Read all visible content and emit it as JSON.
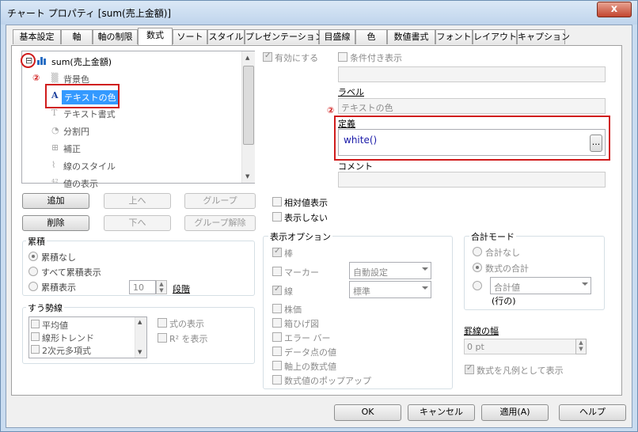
{
  "window": {
    "title": "チャート プロパティ [sum(売上金額)]",
    "close": "x"
  },
  "tabs": [
    "基本設定",
    "軸",
    "軸の制限",
    "数式",
    "ソート",
    "スタイル",
    "プレゼンテーション",
    "目盛線",
    "色",
    "数値書式",
    "フォント",
    "レイアウト",
    "キャプション"
  ],
  "tree": {
    "expander": "⊟",
    "root": "sum(売上金額)",
    "items": [
      "背景色",
      "テキストの色",
      "テキスト書式",
      "分割円",
      "補正",
      "線のスタイル",
      "値の表示"
    ],
    "selected_index": 1
  },
  "annotations": {
    "marker1": "②",
    "marker2": "②"
  },
  "buttons": {
    "add": "追加",
    "up": "上へ",
    "group": "グループ",
    "delete": "削除",
    "down": "下へ",
    "ungroup": "グループ解除",
    "ok": "OK",
    "cancel": "キャンセル",
    "apply": "適用(A)",
    "help": "ヘルプ",
    "ellipsis": "..."
  },
  "right": {
    "enabled": "有効にする",
    "conditional": "条件付き表示",
    "label_title": "ラベル",
    "label_value": "テキストの色",
    "definition_title": "定義",
    "definition_value": "white()",
    "comment_title": "コメント"
  },
  "accumulation": {
    "title": "累積",
    "options": [
      "累積なし",
      "すべて累積表示",
      "累積表示"
    ],
    "selected": 0,
    "steps_value": "10",
    "steps_label": "段階"
  },
  "trendlines": {
    "title": "すう勢線",
    "items": [
      "平均値",
      "線形トレンド",
      "2次元多項式"
    ],
    "show_formula": "式の表示",
    "show_r2": "R² を表示"
  },
  "mid": {
    "relative": "相対値表示",
    "hide": "表示しない"
  },
  "display_options": {
    "title": "表示オプション",
    "bar": "棒",
    "marker": "マーカー",
    "marker_value": "自動設定",
    "line": "線",
    "line_value": "標準",
    "items": [
      "株価",
      "箱ひげ図",
      "エラー バー",
      "データ点の値",
      "軸上の数式値",
      "数式値のポップアップ"
    ]
  },
  "total_mode": {
    "title": "合計モード",
    "options": [
      "合計なし",
      "数式の合計"
    ],
    "selected": 1,
    "sum_select": "合計値",
    "rows_label": "(行の)"
  },
  "line_width": {
    "title": "罫線の幅",
    "value": "0 pt"
  },
  "legend_formula": "数式を凡例として表示",
  "colors": {
    "accent": "#3399ff",
    "highlight": "#d01c1c"
  }
}
